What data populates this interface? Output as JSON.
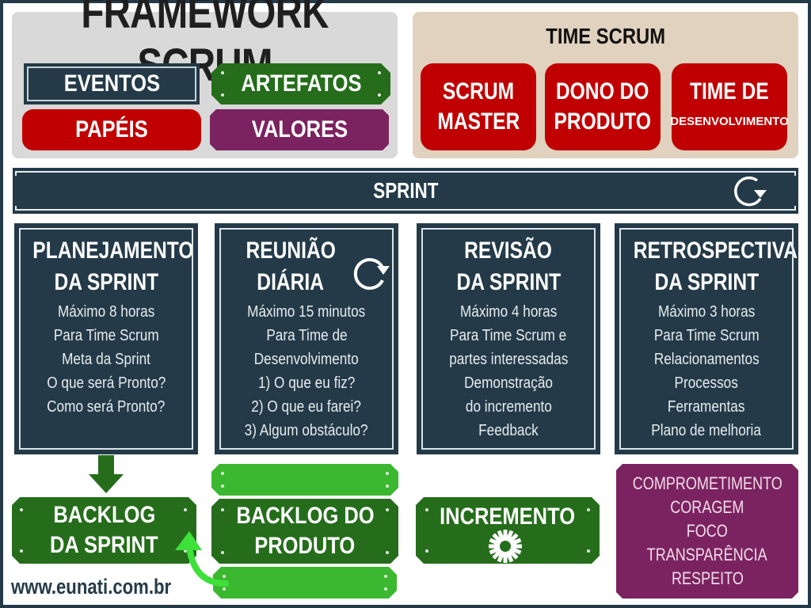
{
  "framework": {
    "title": "FRAMEWORK SCRUM",
    "categories": [
      {
        "label": "EVENTOS",
        "color": "#243a48"
      },
      {
        "label": "ARTEFATOS",
        "color": "#256d1b"
      },
      {
        "label": "PAPÉIS",
        "color": "#c00000"
      },
      {
        "label": "VALORES",
        "color": "#7b2360"
      }
    ]
  },
  "time_scrum": {
    "title": "TIME SCRUM",
    "roles": [
      {
        "line1": "SCRUM",
        "line2": "MASTER"
      },
      {
        "line1": "DONO DO",
        "line2": "PRODUTO"
      },
      {
        "line1": "TIME DE",
        "line2": "DESENVOLVIMENTO"
      }
    ]
  },
  "sprint": {
    "label": "SPRINT",
    "icon": "cycle-icon"
  },
  "events": [
    {
      "title1": "PLANEJAMENTO",
      "title2": "DA SPRINT",
      "lines": [
        "Máximo 8 horas",
        "Para Time Scrum",
        "Meta da Sprint",
        "O que será Pronto?",
        "Como será Pronto?"
      ]
    },
    {
      "title1": "REUNIÃO",
      "title2": "DIÁRIA",
      "lines": [
        "Máximo 15 minutos",
        "Para Time de",
        "Desenvolvimento",
        "1) O que eu fiz?",
        "2) O que eu farei?",
        "3) Algum obstáculo?"
      ]
    },
    {
      "title1": "REVISÃO",
      "title2": "DA SPRINT",
      "lines": [
        "Máximo 4 horas",
        "Para Time Scrum e",
        "partes interessadas",
        "Demonstração",
        "do incremento",
        "Feedback"
      ]
    },
    {
      "title1": "RETROSPECTIVA",
      "title2": "DA SPRINT",
      "lines": [
        "Máximo 3 horas",
        "Para Time Scrum",
        "Relacionamentos",
        "Processos",
        "Ferramentas",
        "Plano de melhoria"
      ]
    }
  ],
  "artifacts": {
    "sprint_backlog": {
      "line1": "BACKLOG",
      "line2": "DA SPRINT"
    },
    "product_backlog": {
      "line1": "BACKLOG DO",
      "line2": "PRODUTO"
    },
    "increment": {
      "label": "INCREMENTO",
      "icon": "gear-icon"
    }
  },
  "values": [
    "COMPROMETIMENTO",
    "CORAGEM",
    "FOCO",
    "TRANSPARÊNCIA",
    "RESPEITO"
  ],
  "footer": {
    "website": "www.eunati.com.br"
  }
}
